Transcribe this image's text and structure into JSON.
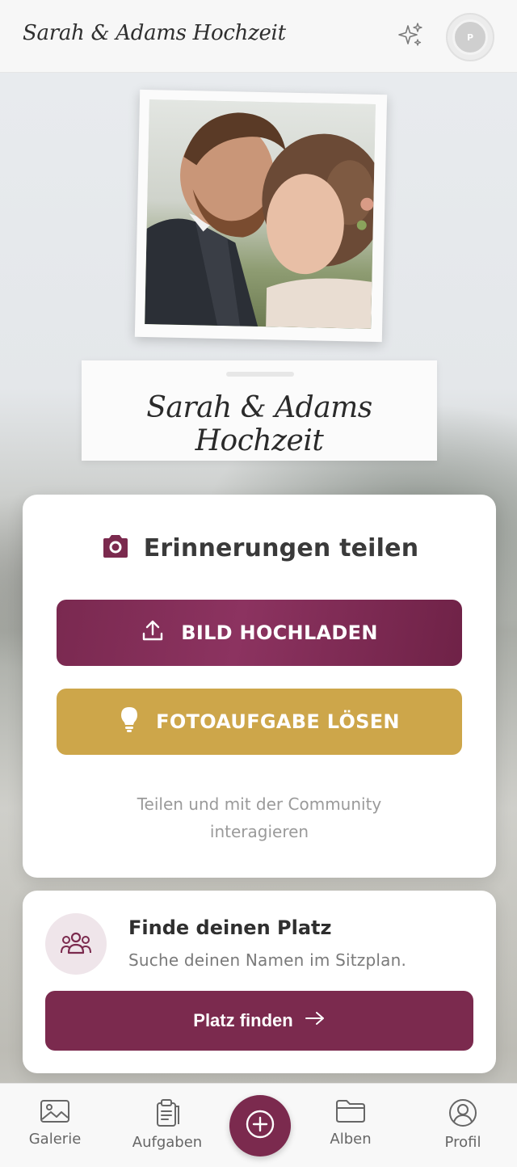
{
  "header": {
    "title": "Sarah & Adams Hochzeit",
    "sparkle_icon": "sparkles-icon",
    "avatar_initial": "P"
  },
  "hero": {
    "photo_alt": "Brautpaar",
    "card_title": "Sarah & Adams Hochzeit"
  },
  "share": {
    "title": "Erinnerungen teilen",
    "icon": "camera-icon",
    "upload_label": "BILD HOCHLADEN",
    "upload_icon": "upload-icon",
    "task_label": "FOTOAUFGABE LÖSEN",
    "task_icon": "lightbulb-icon",
    "subtitle": "Teilen und mit der Community interagieren"
  },
  "seat": {
    "title": "Finde deinen Platz",
    "subtitle": "Suche deinen Namen im Sitzplan.",
    "icon": "group-icon",
    "button_label": "Platz finden",
    "button_icon": "arrow-right-icon"
  },
  "nav": {
    "items": [
      {
        "label": "Galerie",
        "icon": "image-icon"
      },
      {
        "label": "Aufgaben",
        "icon": "clipboard-icon"
      },
      {
        "label": "",
        "icon": "plus-circle-icon"
      },
      {
        "label": "Alben",
        "icon": "folder-icon"
      },
      {
        "label": "Profil",
        "icon": "user-circle-icon"
      }
    ]
  },
  "colors": {
    "brand": "#7b2a4e",
    "accent_gold": "#cda64a",
    "card_bg": "#ffffff"
  }
}
